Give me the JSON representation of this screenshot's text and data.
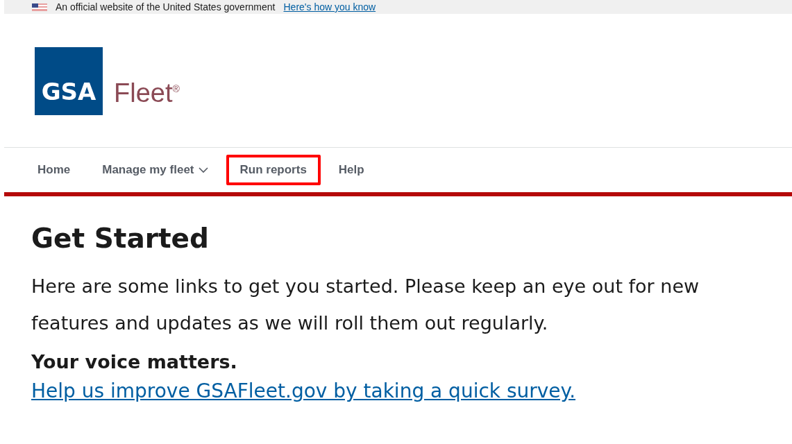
{
  "banner": {
    "text": "An official website of the United States government",
    "link": "Here's how you know"
  },
  "logo": {
    "mark": "GSA",
    "name": "Fleet",
    "registered": "®"
  },
  "nav": [
    {
      "label": "Home",
      "dropdown": false,
      "highlighted": false
    },
    {
      "label": "Manage my fleet",
      "dropdown": true,
      "highlighted": false
    },
    {
      "label": "Run reports",
      "dropdown": false,
      "highlighted": true
    },
    {
      "label": "Help",
      "dropdown": false,
      "highlighted": false
    }
  ],
  "heading": "Get Started",
  "intro": "Here are some links to get you started. Please keep an eye out for new features and updates as we will roll them out regularly.",
  "voice": {
    "title": "Your voice matters.",
    "link": "Help us improve GSAFleet.gov by taking a quick survey."
  }
}
